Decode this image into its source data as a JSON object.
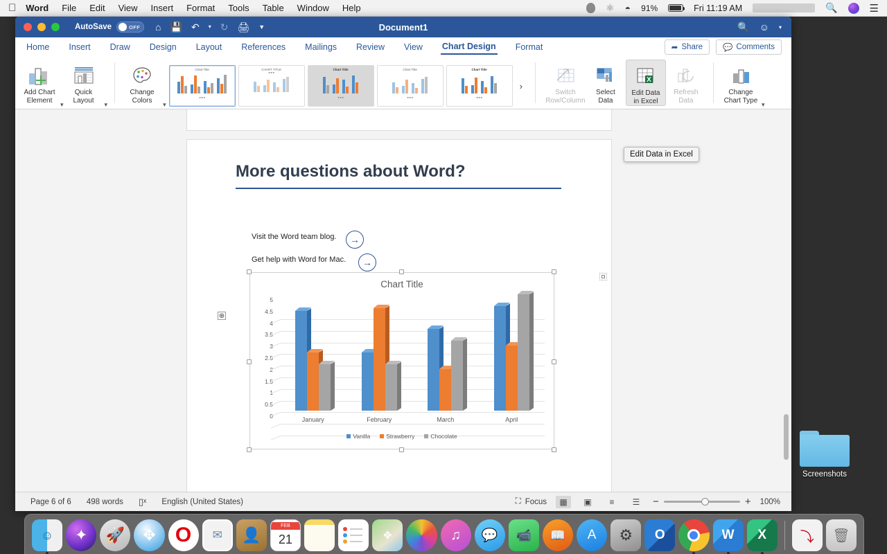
{
  "menubar": {
    "apple_icon": "apple-icon",
    "items": [
      "Word",
      "File",
      "Edit",
      "View",
      "Insert",
      "Format",
      "Tools",
      "Table",
      "Window",
      "Help"
    ],
    "battery_percent": "91%",
    "clock": "Fri 11:19 AM",
    "icons": [
      "siri-blob-icon",
      "creative-cloud-icon",
      "wifi-icon",
      "battery-icon",
      "spotlight-search-icon",
      "siri-icon",
      "notification-center-icon"
    ]
  },
  "window": {
    "title": "Document1",
    "autosave_label": "AutoSave",
    "autosave_state": "OFF",
    "quick_access": [
      "home-icon",
      "save-icon",
      "undo-icon",
      "undo-dropdown-icon",
      "redo-icon",
      "print-icon",
      "customize-toolbar-icon"
    ],
    "search_icon": "search-icon",
    "smiley_icon": "feedback-smiley-icon"
  },
  "ribbon": {
    "tabs": [
      "Home",
      "Insert",
      "Draw",
      "Design",
      "Layout",
      "References",
      "Mailings",
      "Review",
      "View",
      "Chart Design",
      "Format"
    ],
    "active_tab": "Chart Design",
    "share_label": "Share",
    "comments_label": "Comments",
    "buttons": [
      {
        "label": "Add Chart\nElement",
        "icon": "add-chart-element-icon",
        "disabled": false,
        "dropdown": true
      },
      {
        "label": "Quick\nLayout",
        "icon": "quick-layout-icon",
        "disabled": false,
        "dropdown": true
      },
      {
        "label": "Change\nColors",
        "icon": "change-colors-palette-icon",
        "disabled": false,
        "dropdown": true
      },
      {
        "label": "Switch\nRow/Column",
        "icon": "switch-row-column-icon",
        "disabled": true,
        "dropdown": false
      },
      {
        "label": "Select\nData",
        "icon": "select-data-icon",
        "disabled": false,
        "dropdown": false
      },
      {
        "label": "Edit Data\nin Excel",
        "icon": "edit-data-in-excel-icon",
        "disabled": false,
        "dropdown": false
      },
      {
        "label": "Refresh\nData",
        "icon": "refresh-data-icon",
        "disabled": true,
        "dropdown": false
      },
      {
        "label": "Change\nChart Type",
        "icon": "change-chart-type-icon",
        "disabled": false,
        "dropdown": true
      }
    ],
    "gallery": {
      "styles": [
        {
          "name": "Style 1",
          "thumb_title": "Chart Title",
          "selected": true,
          "hover": false,
          "bg": "#ffffff",
          "title_bold": false
        },
        {
          "name": "Style 2",
          "thumb_title": "CHART TITLE",
          "selected": false,
          "hover": false,
          "bg": "#ffffff",
          "title_bold": false
        },
        {
          "name": "Style 3",
          "thumb_title": "Chart Title",
          "selected": false,
          "hover": true,
          "bg": "#d8d8d8",
          "title_bold": true
        },
        {
          "name": "Style 4",
          "thumb_title": "Chart Title",
          "selected": false,
          "hover": false,
          "bg": "#ffffff",
          "title_bold": false
        },
        {
          "name": "Style 5",
          "thumb_title": "Chart Title",
          "selected": false,
          "hover": false,
          "bg": "#ffffff",
          "title_bold": false
        }
      ],
      "next_arrow": "chevron-right-icon"
    },
    "tooltip": "Edit Data in Excel"
  },
  "document": {
    "heading": "More questions about Word?",
    "lines": [
      {
        "text": "Visit the Word team blog.",
        "arrow": "arrow-right-circle-icon"
      },
      {
        "text": "Get help with Word for Mac.",
        "arrow": "arrow-right-circle-icon"
      }
    ],
    "move_handle_icon": "move-object-handle-icon",
    "layout_options_icon": "layout-options-icon"
  },
  "chart_data": {
    "type": "bar",
    "title": "Chart Title",
    "categories": [
      "January",
      "February",
      "March",
      "April"
    ],
    "series": [
      {
        "name": "Vanilla",
        "color": "#4E8FCC",
        "values": [
          4.3,
          2.5,
          3.5,
          4.5
        ]
      },
      {
        "name": "Strawberry",
        "color": "#ED7D31",
        "values": [
          2.5,
          4.4,
          1.8,
          2.8
        ]
      },
      {
        "name": "Chocolate",
        "color": "#A5A5A5",
        "values": [
          2.0,
          2.0,
          3.0,
          5.0
        ]
      }
    ],
    "ylim": [
      0,
      5
    ],
    "yticks": [
      0,
      0.5,
      1,
      1.5,
      2,
      2.5,
      3,
      3.5,
      4,
      4.5,
      5
    ],
    "ytick_labels": [
      "0",
      "0.5",
      "1",
      "1.5",
      "2",
      "2.5",
      "3",
      "3.5",
      "4",
      "4.5",
      "5"
    ],
    "xlabel": "",
    "ylabel": "",
    "grid": true,
    "legend_position": "bottom",
    "style": "3-D clustered column"
  },
  "statusbar": {
    "page": "Page 6 of 6",
    "words": "498 words",
    "proofing_icon": "spelling-check-icon",
    "language": "English (United States)",
    "focus_label": "Focus",
    "focus_icon": "focus-mode-icon",
    "views": [
      "print-layout-icon",
      "web-layout-icon",
      "outline-icon",
      "draft-icon"
    ],
    "active_view": "print-layout-icon",
    "zoom_out_icon": "zoom-out-icon",
    "zoom_in_icon": "zoom-in-icon",
    "zoom_level": "100%"
  },
  "desktop": {
    "icons": [
      {
        "label": "Screenshots",
        "icon": "folder-icon"
      }
    ]
  },
  "dock": {
    "items": [
      {
        "name": "finder",
        "running": true
      },
      {
        "name": "siri",
        "running": false
      },
      {
        "name": "launchpad",
        "running": false
      },
      {
        "name": "safari",
        "running": false
      },
      {
        "name": "opera",
        "running": false
      },
      {
        "name": "mail",
        "running": false
      },
      {
        "name": "contacts",
        "running": false
      },
      {
        "name": "calendar",
        "running": false,
        "badge": "21",
        "badge_month": "FEB"
      },
      {
        "name": "notes",
        "running": false
      },
      {
        "name": "reminders",
        "running": false
      },
      {
        "name": "maps",
        "running": false
      },
      {
        "name": "photos",
        "running": false
      },
      {
        "name": "itunes",
        "running": false
      },
      {
        "name": "messages",
        "running": false
      },
      {
        "name": "facetime",
        "running": false
      },
      {
        "name": "books",
        "running": false
      },
      {
        "name": "app-store",
        "running": false
      },
      {
        "name": "system-preferences",
        "running": false
      },
      {
        "name": "outlook",
        "running": false
      },
      {
        "name": "chrome",
        "running": true
      },
      {
        "name": "word",
        "running": true
      },
      {
        "name": "excel",
        "running": true
      },
      {
        "name": "downloads",
        "running": false
      },
      {
        "name": "trash",
        "running": false
      }
    ]
  }
}
